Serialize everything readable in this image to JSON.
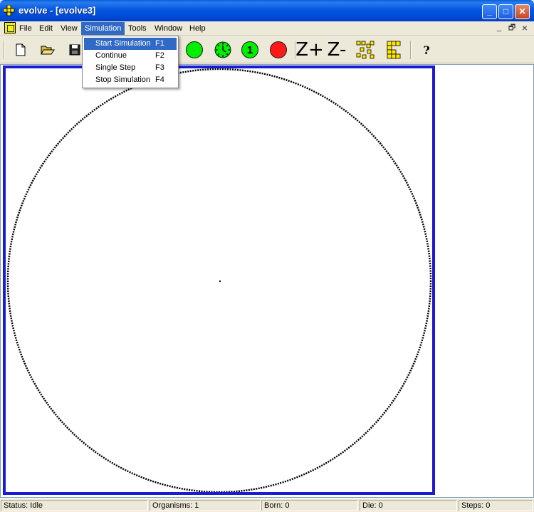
{
  "window": {
    "title": "evolve - [evolve3]",
    "buttons": {
      "minimize": "_",
      "maximize": "□",
      "close": "✕"
    }
  },
  "menubar": {
    "items": [
      "File",
      "Edit",
      "View",
      "Simulation",
      "Tools",
      "Window",
      "Help"
    ],
    "active": "Simulation",
    "mdi_buttons": {
      "minimize": "_",
      "restore": "🗗",
      "close": "×"
    }
  },
  "simulation_menu": {
    "items": [
      {
        "label": "Start Simulation",
        "key": "F1"
      },
      {
        "label": "Continue",
        "key": "F2"
      },
      {
        "label": "Single Step",
        "key": "F3"
      },
      {
        "label": "Stop Simulation",
        "key": "F4"
      }
    ]
  },
  "toolbar": {
    "single_step_glyph": "1",
    "zoom_in_glyph": "Z+",
    "zoom_out_glyph": "Z-",
    "help_glyph": "?",
    "colors": {
      "go": "#00ee00",
      "stop": "#ff1a1a"
    }
  },
  "canvas": {
    "border_color": "#1b1bd6",
    "ring_color": "#000000"
  },
  "statusbar": {
    "status": "Status: Idle",
    "organisms": "Organisms: 1",
    "born": "Born: 0",
    "die": "Die: 0",
    "steps": "Steps: 0"
  }
}
